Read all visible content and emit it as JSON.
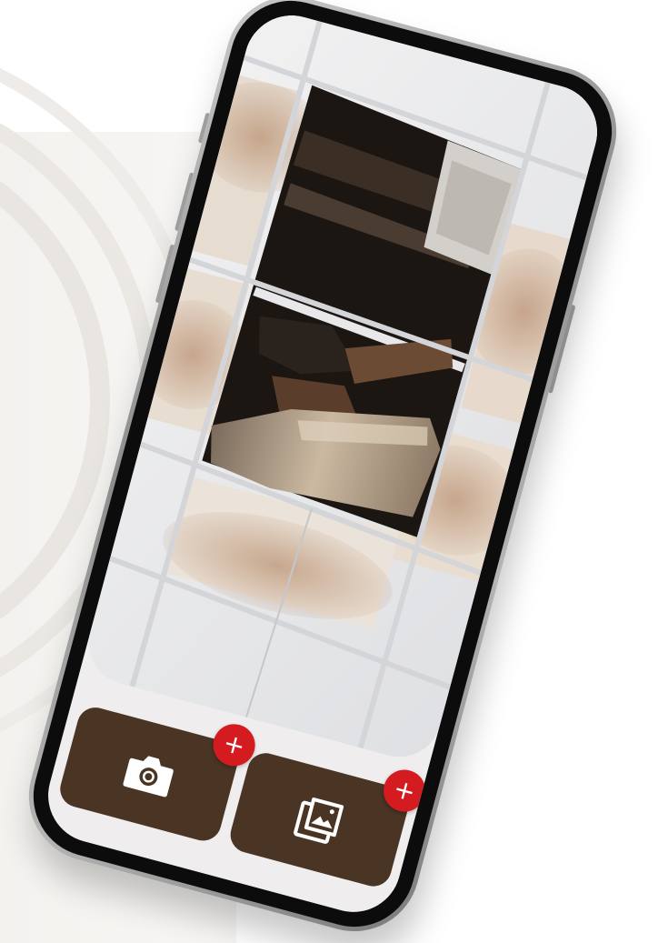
{
  "scene": {
    "description_free": true,
    "accent_colors": {
      "button_bg": "#4a3524",
      "badge_bg": "#d41b1f",
      "badge_fg": "#ffffff",
      "screen_bg": "#efedee"
    }
  },
  "photo": {
    "icon": "damaged-ceiling-photo"
  },
  "actions": {
    "camera": {
      "icon": "camera-icon",
      "badge": "+"
    },
    "gallery": {
      "icon": "image-gallery-icon",
      "badge": "+"
    }
  }
}
